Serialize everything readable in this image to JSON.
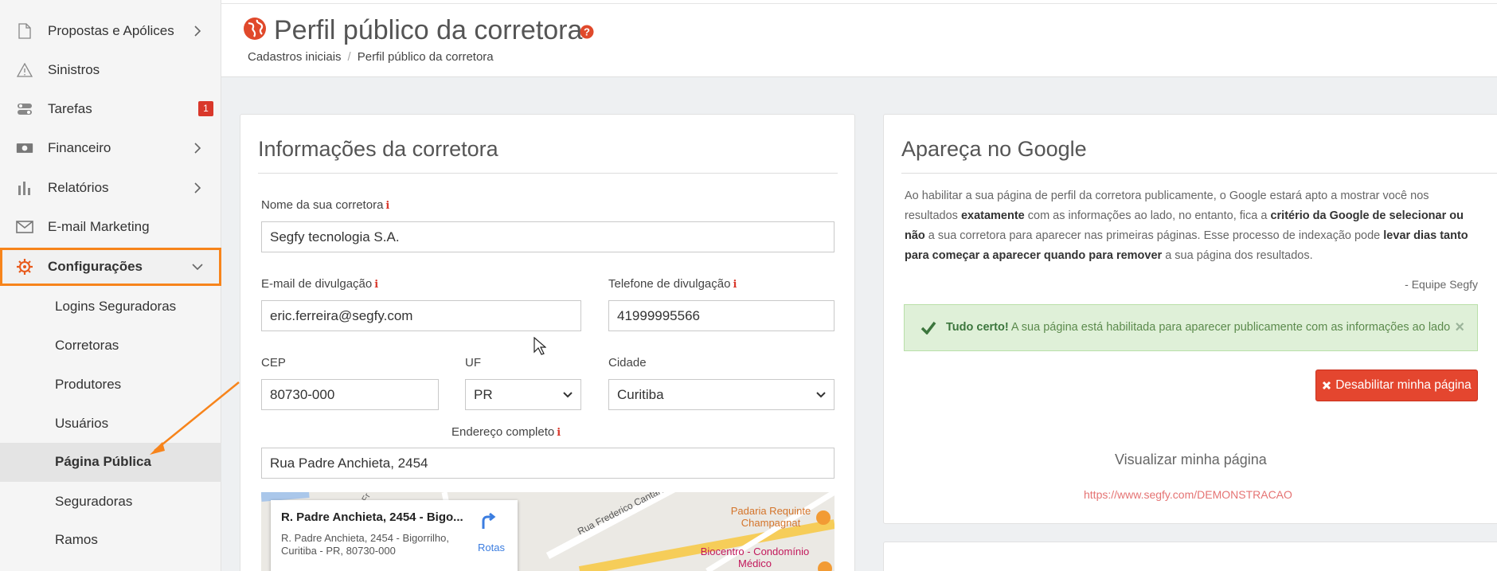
{
  "sidebar": {
    "items": [
      {
        "label": "Propostas e Apólices",
        "icon": "file-icon",
        "chevron": true
      },
      {
        "label": "Sinistros",
        "icon": "warning-icon"
      },
      {
        "label": "Tarefas",
        "icon": "toggles-icon",
        "badge": "1"
      },
      {
        "label": "Financeiro",
        "icon": "money-icon",
        "chevron": true
      },
      {
        "label": "Relatórios",
        "icon": "bar-chart-icon",
        "chevron": true
      },
      {
        "label": "E-mail Marketing",
        "icon": "envelope-icon"
      },
      {
        "label": "Configurações",
        "icon": "gear-icon",
        "expanded": true
      }
    ],
    "subitems": [
      "Logins Seguradoras",
      "Corretoras",
      "Produtores",
      "Usuários",
      "Página Pública",
      "Seguradoras",
      "Ramos"
    ],
    "current_subitem": "Página Pública"
  },
  "header": {
    "title": "Perfil público da corretora",
    "breadcrumb": [
      "Cadastros iniciais",
      "Perfil público da corretora"
    ]
  },
  "form_panel": {
    "title": "Informações da corretora",
    "name_label": "Nome da sua corretora",
    "name_value": "Segfy tecnologia S.A.",
    "email_label": "E-mail de divulgação",
    "email_value": "eric.ferreira@segfy.com",
    "phone_label": "Telefone de divulgação",
    "phone_value": "41999995566",
    "cep_label": "CEP",
    "cep_value": "80730-000",
    "uf_label": "UF",
    "uf_value": "PR",
    "city_label": "Cidade",
    "city_value": "Curitiba",
    "address_label": "Endereço completo",
    "address_value": "Rua Padre Anchieta, 2454",
    "info_marker": "i",
    "map": {
      "card_title": "R. Padre Anchieta, 2454 - Bigo...",
      "card_address": "R. Padre Anchieta, 2454 - Bigorrilho, Curitiba - PR, 80730-000",
      "routes_label": "Rotas",
      "street_label": "Rua Frederico Cantarelli",
      "poi_1": "Padaria Requinte Champagnat",
      "poi_2": "Biocentro - Condomínio Médico",
      "street_fragment": "Fr"
    }
  },
  "google_panel": {
    "title": "Apareça no Google",
    "desc_1": "Ao habilitar a sua página de perfil da corretora publicamente, o Google estará apto a mostrar você nos resultados ",
    "desc_b1": "exatamente",
    "desc_2": " com as informações ao lado, no entanto, fica a ",
    "desc_b2": "critério da Google de selecionar ou não",
    "desc_3": " a sua corretora para aparecer nas primeiras páginas. Esse processo de indexação pode ",
    "desc_b3": "levar dias tanto para começar a aparecer quando para remover",
    "desc_4": " a sua página dos resultados.",
    "signature": "- Equipe Segfy",
    "alert_strong": "Tudo certo!",
    "alert_text": " A sua página está habilitada para aparecer publicamente com as informações ao lado",
    "alert_close": "×",
    "disable_button": "Desabilitar minha página",
    "view_label": "Visualizar minha página",
    "view_url": "https://www.segfy.com/DEMONSTRACAO"
  },
  "colors": {
    "accent": "#f7841b",
    "danger": "#e4462f",
    "success_bg": "#dff0d8",
    "badge": "#d9382b"
  }
}
